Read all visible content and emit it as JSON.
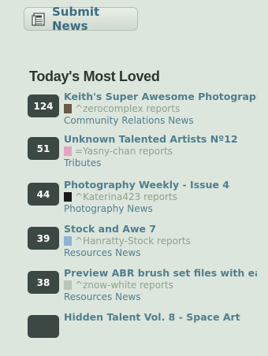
{
  "submit": {
    "label": "Submit News"
  },
  "section": {
    "title": "Today's Most Loved"
  },
  "items": [
    {
      "count": "124",
      "title": "Keith's Super Awesome Photography",
      "reporter": "^zerocomplex reports",
      "category": "Community Relations News",
      "avatar_color": "#6b5a48"
    },
    {
      "count": "51",
      "title": "Unknown Talented Artists Nº12",
      "reporter": "=Yasny-chan reports",
      "category": "Tributes",
      "avatar_color": "#e7a4c0"
    },
    {
      "count": "44",
      "title": "Photography Weekly - Issue 4",
      "reporter": "^Katerina423 reports",
      "category": "Photography News",
      "avatar_color": "#1a1a1a"
    },
    {
      "count": "39",
      "title": "Stock and Awe 7",
      "reporter": "^Hanratty-Stock reports",
      "category": "Resources News",
      "avatar_color": "#8fb3d8"
    },
    {
      "count": "38",
      "title": "Preview ABR brush set files with eas",
      "reporter": "^znow-white reports",
      "category": "Resources News",
      "avatar_color": "#b9c5b9"
    },
    {
      "count": "",
      "title": "Hidden Talent Vol. 8 - Space Art",
      "reporter": "",
      "category": "",
      "avatar_color": "#3c4843"
    }
  ]
}
